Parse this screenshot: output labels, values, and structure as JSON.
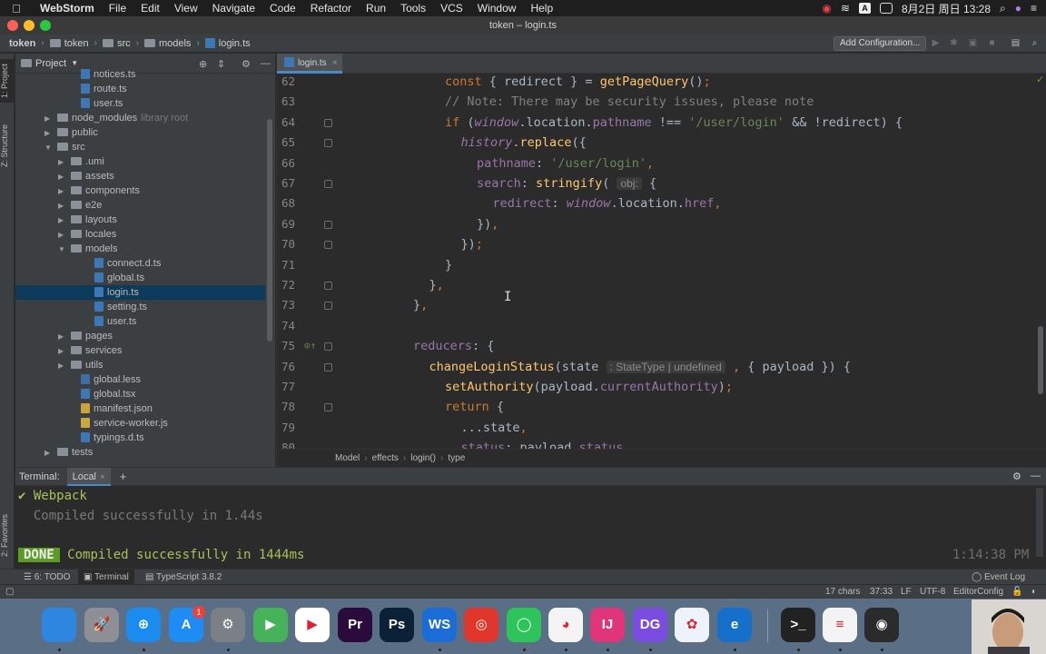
{
  "menubar": {
    "app_name": "WebStorm",
    "items": [
      "File",
      "Edit",
      "View",
      "Navigate",
      "Code",
      "Refactor",
      "Run",
      "Tools",
      "VCS",
      "Window",
      "Help"
    ],
    "datetime": "8月2日 周日 13:28",
    "input_badge": "A"
  },
  "window": {
    "title": "token – login.ts"
  },
  "navbar": {
    "crumbs": [
      "token",
      "token",
      "src",
      "models",
      "login.ts"
    ],
    "add_configuration": "Add Configuration..."
  },
  "project": {
    "title": "Project",
    "rows": [
      {
        "label": "notices.ts",
        "type": "ts",
        "indent": 4,
        "arrow": ""
      },
      {
        "label": "route.ts",
        "type": "ts",
        "indent": 4,
        "arrow": ""
      },
      {
        "label": "user.ts",
        "type": "ts",
        "indent": 4,
        "arrow": ""
      },
      {
        "label": "node_modules",
        "type": "folder",
        "indent": 2,
        "arrow": "▶",
        "hint": "library root"
      },
      {
        "label": "public",
        "type": "folder",
        "indent": 2,
        "arrow": "▶"
      },
      {
        "label": "src",
        "type": "folder",
        "indent": 2,
        "arrow": "▼"
      },
      {
        "label": ".umi",
        "type": "folder",
        "indent": 3,
        "arrow": "▶"
      },
      {
        "label": "assets",
        "type": "folder",
        "indent": 3,
        "arrow": "▶"
      },
      {
        "label": "components",
        "type": "folder",
        "indent": 3,
        "arrow": "▶"
      },
      {
        "label": "e2e",
        "type": "folder",
        "indent": 3,
        "arrow": "▶"
      },
      {
        "label": "layouts",
        "type": "folder",
        "indent": 3,
        "arrow": "▶"
      },
      {
        "label": "locales",
        "type": "folder",
        "indent": 3,
        "arrow": "▶"
      },
      {
        "label": "models",
        "type": "folder",
        "indent": 3,
        "arrow": "▼"
      },
      {
        "label": "connect.d.ts",
        "type": "ts",
        "indent": 5,
        "arrow": ""
      },
      {
        "label": "global.ts",
        "type": "ts",
        "indent": 5,
        "arrow": ""
      },
      {
        "label": "login.ts",
        "type": "ts",
        "indent": 5,
        "arrow": "",
        "selected": true
      },
      {
        "label": "setting.ts",
        "type": "ts",
        "indent": 5,
        "arrow": ""
      },
      {
        "label": "user.ts",
        "type": "ts",
        "indent": 5,
        "arrow": ""
      },
      {
        "label": "pages",
        "type": "folder",
        "indent": 3,
        "arrow": "▶"
      },
      {
        "label": "services",
        "type": "folder",
        "indent": 3,
        "arrow": "▶"
      },
      {
        "label": "utils",
        "type": "folder",
        "indent": 3,
        "arrow": "▶"
      },
      {
        "label": "global.less",
        "type": "less",
        "indent": 4,
        "arrow": ""
      },
      {
        "label": "global.tsx",
        "type": "tsx",
        "indent": 4,
        "arrow": ""
      },
      {
        "label": "manifest.json",
        "type": "json",
        "indent": 4,
        "arrow": ""
      },
      {
        "label": "service-worker.js",
        "type": "js",
        "indent": 4,
        "arrow": ""
      },
      {
        "label": "typings.d.ts",
        "type": "ts",
        "indent": 4,
        "arrow": ""
      },
      {
        "label": "tests",
        "type": "folder",
        "indent": 2,
        "arrow": "▶"
      }
    ]
  },
  "editor": {
    "tab": "login.ts",
    "lines": [
      {
        "n": "62",
        "indent": 6,
        "html": "<span class='kw'>const</span> { redirect } = <span class='fn'>getPageQuery</span>()<span class='kw'>;</span>"
      },
      {
        "n": "63",
        "indent": 6,
        "html": "<span class='cmt'>// Note: There may be security issues, please note</span>"
      },
      {
        "n": "64",
        "indent": 6,
        "html": "<span class='kw'>if</span> (<span class='gl'>window</span>.location.<span class='prop'>pathname</span> !== <span class='str'>'/user/login'</span> &amp;&amp; !redirect) {"
      },
      {
        "n": "65",
        "indent": 7,
        "html": "<span class='fnit'>history</span>.<span class='fn'>replace</span>({"
      },
      {
        "n": "66",
        "indent": 8,
        "html": "<span class='prop'>pathname</span>: <span class='str'>'/user/login'</span><span class='kw'>,</span>"
      },
      {
        "n": "67",
        "indent": 8,
        "html": "<span class='prop'>search</span>: <span class='fn'>stringify</span>( <span class='hint-box'>obj:</span> {"
      },
      {
        "n": "68",
        "indent": 9,
        "html": "<span class='prop'>redirect</span>: <span class='gl'>window</span>.location.<span class='prop'>href</span><span class='kw'>,</span>"
      },
      {
        "n": "69",
        "indent": 8,
        "html": "})<span class='kw'>,</span>"
      },
      {
        "n": "70",
        "indent": 7,
        "html": "})<span class='kw'>;</span>"
      },
      {
        "n": "71",
        "indent": 6,
        "html": "}"
      },
      {
        "n": "72",
        "indent": 5,
        "html": "}<span class='kw'>,</span>"
      },
      {
        "n": "73",
        "indent": 4,
        "html": "}<span class='kw'>,</span>"
      },
      {
        "n": "74",
        "indent": 0,
        "html": ""
      },
      {
        "n": "75",
        "indent": 4,
        "html": "<span class='prop'>reducers</span>: {"
      },
      {
        "n": "76",
        "indent": 5,
        "html": "<span class='fn'>changeLoginStatus</span>(state <span class='hint-box'>: StateType | undefined</span> <span class='kw'>,</span> { payload }) {"
      },
      {
        "n": "77",
        "indent": 6,
        "html": "<span class='fn'>setAuthority</span>(payload.<span class='prop'>currentAuthority</span>)<span class='kw'>;</span>"
      },
      {
        "n": "78",
        "indent": 6,
        "html": "<span class='kw'>return</span> {"
      },
      {
        "n": "79",
        "indent": 7,
        "html": "...state<span class='kw'>,</span>"
      },
      {
        "n": "80",
        "indent": 7,
        "html": "<span class='prop'>status</span>: payload.<span class='prop'>status</span>"
      }
    ],
    "breadcrumbs": [
      "Model",
      "effects",
      "login()",
      "type"
    ]
  },
  "terminal": {
    "title": "Terminal:",
    "tab": "Local",
    "line1": "✔ Webpack",
    "line2": "  Compiled successfully in 1.44s",
    "done": "DONE",
    "line3": "Compiled successfully in 1444ms",
    "time": "1:14:38 PM"
  },
  "bottom_tabs": {
    "todo": "6: TODO",
    "terminal": "Terminal",
    "typescript": "TypeScript 3.8.2",
    "event_log": "Event Log"
  },
  "status": {
    "chars": "17 chars",
    "position": "37:33",
    "line_sep": "LF",
    "encoding": "UTF-8",
    "editorconfig": "EditorConfig"
  },
  "sidebar_tabs": {
    "project": "1: Project",
    "structure": "Z: Structure",
    "favorites": "2: Favorites"
  },
  "dock": {
    "app_store_badge": "1",
    "apps": [
      {
        "name": "finder",
        "label": "",
        "color": "#2f86e0"
      },
      {
        "name": "launchpad",
        "label": "🚀",
        "color": "#8d8f94"
      },
      {
        "name": "safari",
        "label": "⊕",
        "color": "#1a8cf0"
      },
      {
        "name": "app-store",
        "label": "A",
        "color": "#1e8cf5"
      },
      {
        "name": "system-preferences",
        "label": "⚙",
        "color": "#7b7f86"
      },
      {
        "name": "infuse",
        "label": "▶",
        "color": "#46b35a"
      },
      {
        "name": "youku",
        "label": "▶",
        "color": "#ffffff"
      },
      {
        "name": "premiere",
        "label": "Pr",
        "color": "#2a0b3c"
      },
      {
        "name": "photoshop",
        "label": "Ps",
        "color": "#0b2236"
      },
      {
        "name": "webstorm",
        "label": "WS",
        "color": "#1a6dd6"
      },
      {
        "name": "netease-music",
        "label": "◎",
        "color": "#e0362c"
      },
      {
        "name": "wechat",
        "label": "◯",
        "color": "#2ec45c"
      },
      {
        "name": "qq",
        "label": "◕",
        "color": "#f4f4f4"
      },
      {
        "name": "intellij",
        "label": "IJ",
        "color": "#e0357a"
      },
      {
        "name": "datagrip",
        "label": "DG",
        "color": "#7a4de0"
      },
      {
        "name": "pinwheel",
        "label": "✿",
        "color": "#eef3fb"
      },
      {
        "name": "edge",
        "label": "e",
        "color": "#1670c9"
      },
      {
        "name": "terminal",
        "label": ">_",
        "color": "#222222"
      },
      {
        "name": "textedit",
        "label": "≡",
        "color": "#f3f3f3"
      },
      {
        "name": "obs",
        "label": "◉",
        "color": "#2b2b2b"
      }
    ]
  }
}
